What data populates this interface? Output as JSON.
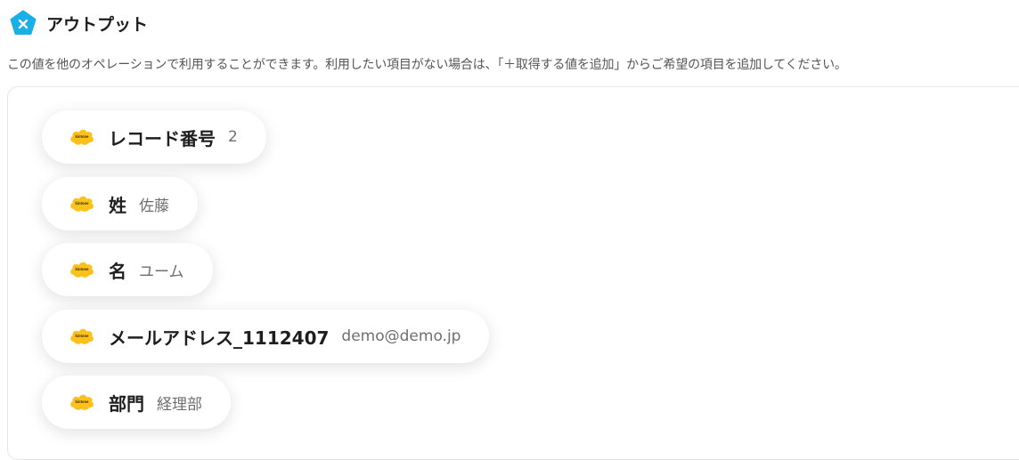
{
  "header": {
    "title": "アウトプット",
    "icon": "close-pentagon-icon",
    "icon_color": "#1ab0e6"
  },
  "description": "この値を他のオペレーションで利用することができます。利用したい項目がない場合は、「＋取得する値を追加」からご希望の項目を追加してください。",
  "fields": [
    {
      "label": "レコード番号",
      "value": "2"
    },
    {
      "label": "姓",
      "value": "佐藤"
    },
    {
      "label": "名",
      "value": "ユーム"
    },
    {
      "label": "メールアドレス_1112407",
      "value": "demo@demo.jp"
    },
    {
      "label": "部門",
      "value": "経理部"
    }
  ],
  "service": {
    "name": "kintone",
    "icon": "kintone-logo-icon",
    "color": "#fcc21b"
  }
}
